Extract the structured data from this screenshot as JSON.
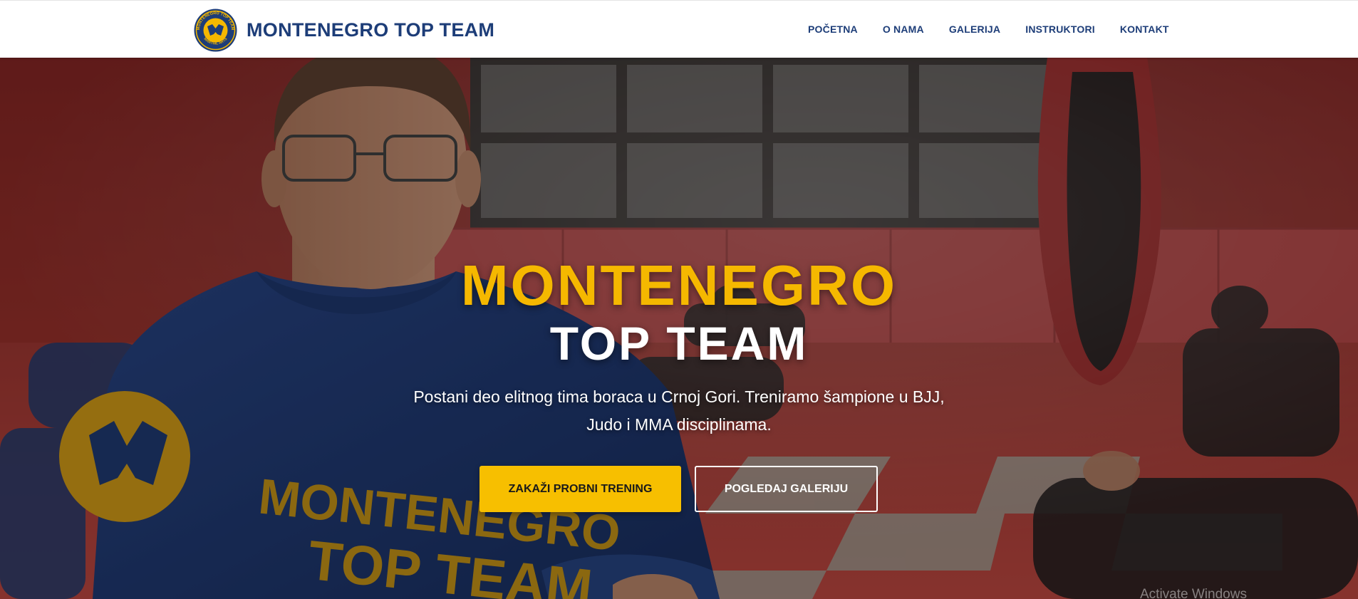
{
  "header": {
    "brand_name": "MONTENEGRO TOP TEAM",
    "logo_text": "MONTENEGRO TOP TEAM",
    "logo_subtext": "MARTIAL ARTS",
    "nav": [
      {
        "label": "POČETNA"
      },
      {
        "label": "O NAMA"
      },
      {
        "label": "GALERIJA"
      },
      {
        "label": "INSTRUKTORI"
      },
      {
        "label": "KONTAKT"
      }
    ]
  },
  "hero": {
    "title_line1": "MONTENEGRO",
    "title_line2": "TOP TEAM",
    "subtitle": "Postani deo elitnog tima boraca u Crnoj Gori. Treniramo šampione u BJJ, Judo i MMA disciplinama.",
    "primary_button": "ZAKAŽI PROBNI TRENING",
    "secondary_button": "POGLEDAJ GALERIJU",
    "shirt_text_line1": "MONTENEGRO",
    "shirt_text_line2": "TOP TEAM"
  },
  "system": {
    "watermark": "Activate Windows"
  },
  "colors": {
    "brand_blue": "#1d3d78",
    "accent_yellow": "#f7bf00",
    "mat_red": "#c8373f",
    "white": "#ffffff"
  }
}
